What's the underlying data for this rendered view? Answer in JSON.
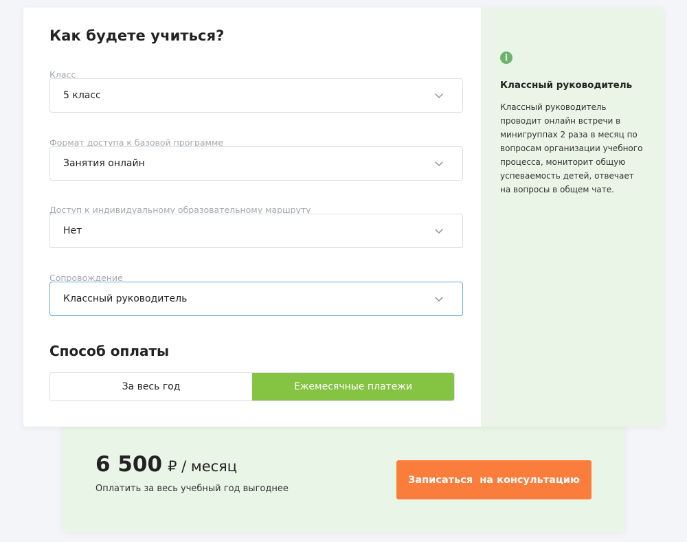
{
  "form": {
    "title": "Как будете учиться?",
    "fields": [
      {
        "label": "Класс",
        "value": "5 класс"
      },
      {
        "label": "Формат доступа к базовой программе",
        "value": "Занятия онлайн"
      },
      {
        "label": "Доступ к индивидуальному образовательному маршруту",
        "value": "Нет"
      },
      {
        "label": "Сопровождение",
        "value": "Классный руководитель"
      }
    ],
    "payment": {
      "title": "Способ оплаты",
      "options": [
        "За весь год",
        "Ежемесячные платежи"
      ],
      "selected": "Ежемесячные платежи"
    }
  },
  "info": {
    "icon": "info-icon",
    "icon_glyph": "i",
    "title": "Классный руководитель",
    "text": "Классный руководитель проводит онлайн встречи в минигруппах 2 раза в месяц по вопросам организации учебного процесса, мониторит общую успеваемость детей, отвечает на вопросы в общем чате."
  },
  "price": {
    "amount": "6 500",
    "unit": "₽ / месяц",
    "note": "Оплатить за весь учебный год выгоднее",
    "cta_label": "Записаться  на консультацию"
  },
  "colors": {
    "accent_green": "#84c442",
    "cta_orange": "#fb7d3c",
    "info_bg": "#eaf5e8",
    "active_border": "#6aa8e0"
  }
}
